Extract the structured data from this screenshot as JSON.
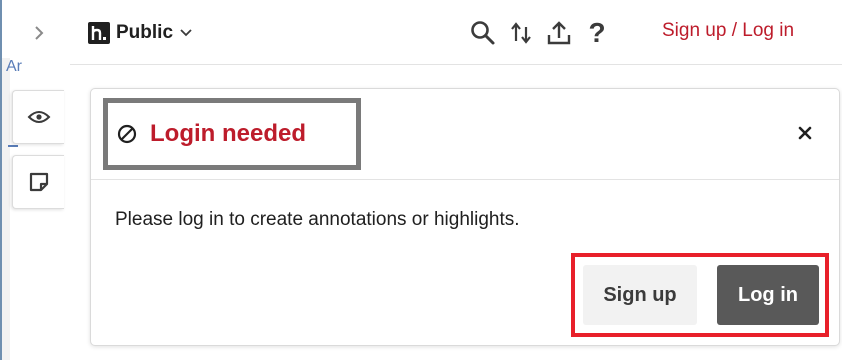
{
  "topbar": {
    "group_name": "Public",
    "auth": {
      "signup_label": "Sign up",
      "separator": " / ",
      "login_label": "Log in"
    },
    "icons": [
      "chevron-right-icon",
      "hypothesis-logo-icon",
      "chevron-down-icon",
      "search-icon",
      "sort-icon",
      "share-icon",
      "help-icon"
    ]
  },
  "page_text_fragment": "Ar",
  "side_tabs": [
    {
      "icon": "eye-icon"
    },
    {
      "icon": "note-icon"
    }
  ],
  "panel": {
    "title": "Login needed",
    "message": "Please log in to create annotations or highlights.",
    "signup_label": "Sign up",
    "login_label": "Log in"
  },
  "help_glyph": "?",
  "colors": {
    "brand_red": "#bd1c2b",
    "highlight_red": "#e8202a",
    "highlight_gray": "#7a7a7a",
    "login_button_bg": "#595959",
    "signup_button_bg": "#f2f2f2"
  }
}
